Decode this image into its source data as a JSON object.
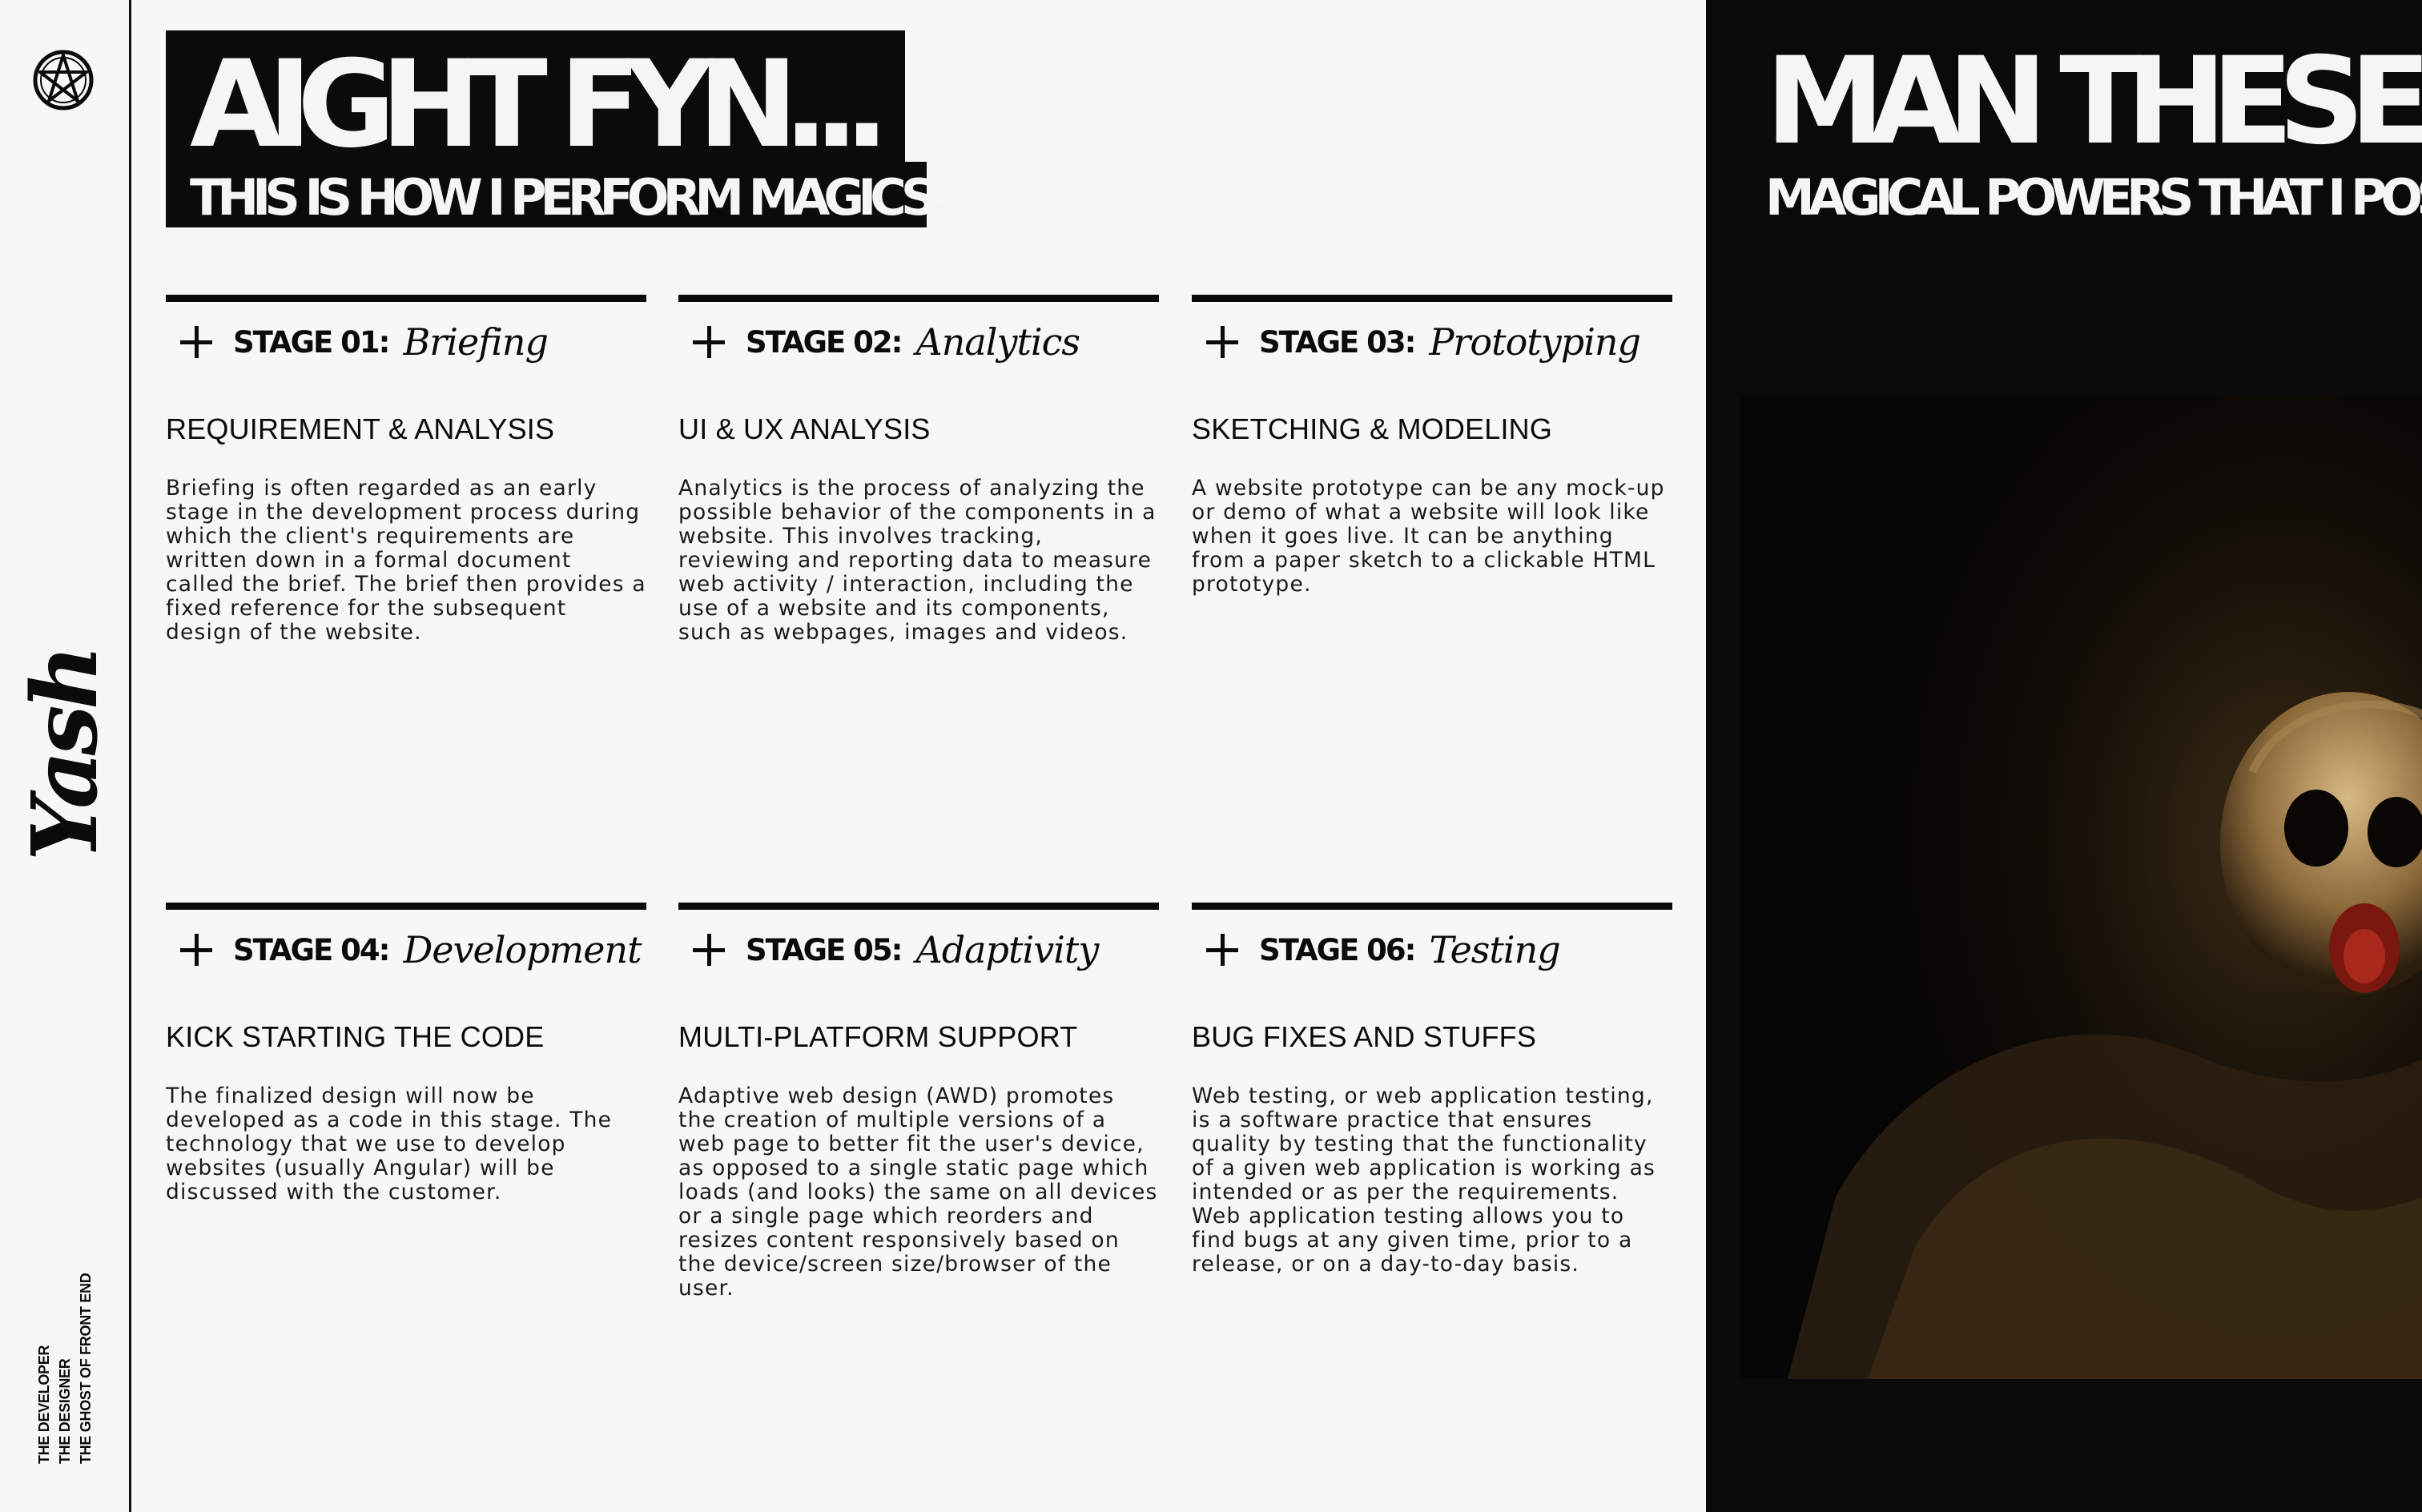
{
  "rail": {
    "logo_icon": "pentagram-icon",
    "signature": "Yash",
    "tags": [
      "THE DEVELOPER",
      "THE DESIGNER",
      "THE GHOST OF FRONT END"
    ]
  },
  "heading": {
    "title": "AIGHT FYN...",
    "subtitle": "THIS IS HOW I PERFORM MAGICS."
  },
  "stages": [
    {
      "number": "STAGE 01:",
      "script": "Briefing",
      "heading": "REQUIREMENT & ANALYSIS",
      "text": "Briefing is often regarded as an early stage in the development process during which the client's requirements are written down in a formal document called the brief. The brief then provides a fixed reference for the subsequent design of the website."
    },
    {
      "number": "STAGE 02:",
      "script": "Analytics",
      "heading": "UI & UX ANALYSIS",
      "text": "Analytics is the process of analyzing the possible behavior of the components in a website. This involves tracking, reviewing and reporting data to measure web activity / interaction, including the use of a website and its components, such as webpages, images and videos."
    },
    {
      "number": "STAGE 03:",
      "script": "Prototyping",
      "heading": "SKETCHING & MODELING",
      "text": "A website prototype can be any mock-up or demo of what a website will look like when it goes live. It can be anything from a paper sketch to a clickable HTML prototype."
    },
    {
      "number": "STAGE 04:",
      "script": "Development",
      "heading": "KICK STARTING THE CODE",
      "text": "The finalized design will now be developed as a code in this stage. The technology that we use to develop websites (usually Angular) will be discussed with the customer."
    },
    {
      "number": "STAGE 05:",
      "script": "Adaptivity",
      "heading": "MULTI-PLATFORM SUPPORT",
      "text": "Adaptive web design (AWD) promotes the creation of multiple versions of a web page to better fit the user's device, as opposed to a single static page which loads (and looks) the same on all devices or a single page which reorders and resizes content responsively based on the device/screen size/browser of the user."
    },
    {
      "number": "STAGE 06:",
      "script": "Testing",
      "heading": "BUG FIXES AND STUFFS",
      "text": "Web testing, or web application testing, is a software practice that ensures quality by testing that the functionality of a given web application is working as intended or as per the requirements. Web application testing allows you to find bugs at any given time, prior to a release, or on a day-to-day basis."
    }
  ],
  "dark_panel": {
    "title": "MAN THESE",
    "subtitle": "MAGICAL POWERS THAT I POS",
    "image": "skull-photo"
  },
  "colors": {
    "background": "#f7f7f7",
    "ink": "#0b0b0b",
    "dark_panel": "#0a0a0b",
    "skull_highlight": "#c9a46a"
  },
  "icons": {
    "stage_expand": "plus-icon"
  }
}
